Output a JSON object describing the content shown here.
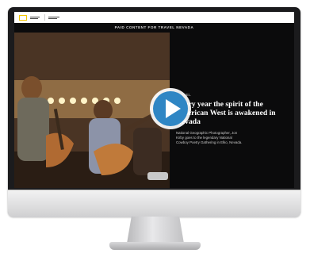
{
  "header": {
    "section_title": "PAID CONTENT FOR TRAVEL NEVADA"
  },
  "article": {
    "kicker": "TRAVEL",
    "headline": "Every year the spirit of the American West is awakened in Nevada",
    "dek": "National Geographic Photographer, Jon Kirby goes to the legendary National Cowboy Poetry Gathering in Elko, Nevada."
  },
  "video": {
    "play_icon": "play-icon",
    "accent": "#2f86c4"
  }
}
